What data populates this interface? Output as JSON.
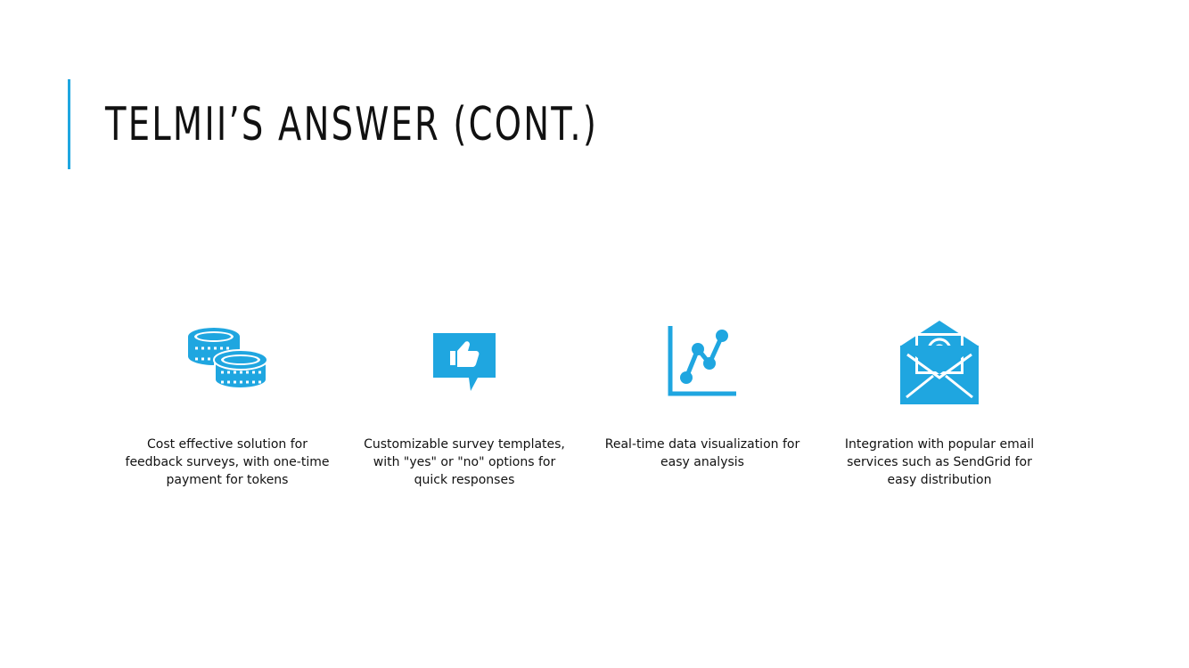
{
  "slide": {
    "title": "TELMII’S ANSWER (CONT.)",
    "accent_color": "#1fa6e0"
  },
  "features": [
    {
      "icon": "coins-icon",
      "text": "Cost effective solution for feedback surveys, with one-time payment for tokens"
    },
    {
      "icon": "thumbs-up-chat-icon",
      "text": "Customizable survey templates, with \"yes\" or \"no\" options for quick responses"
    },
    {
      "icon": "line-chart-icon",
      "text": "Real-time data visualization for easy analysis"
    },
    {
      "icon": "email-envelope-icon",
      "text": "Integration with popular email services such as SendGrid for easy distribution"
    }
  ]
}
